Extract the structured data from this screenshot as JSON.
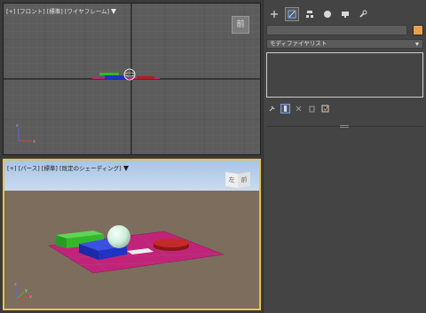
{
  "viewports": {
    "top": {
      "label": "[+] [フロント] [標準] [ワイヤフレーム]",
      "cube_label": "前"
    },
    "perspective": {
      "label": "[+] [パース] [標準] [既定のシェーディング]",
      "cube_left": "左",
      "cube_right": "前"
    }
  },
  "command_panel": {
    "tabs": [
      "create-tab",
      "modify-tab",
      "hierarchy-tab",
      "motion-tab",
      "display-tab",
      "utilities-tab"
    ],
    "active_tab": "modify-tab",
    "object_name": "",
    "object_color": "#e6a14a",
    "modifier_list_label": "モディファイヤリスト",
    "stack_tools": [
      "pin-stack-icon",
      "show-end-result-icon",
      "make-unique-icon",
      "remove-modifier-icon",
      "configure-modifier-sets-icon"
    ]
  },
  "colors": {
    "sky": "#b4cce8",
    "ground": "#7c6d5d",
    "plane": "#c2237a",
    "box_green": "#33b82c",
    "box_blue": "#1f33c4",
    "sphere": "#d4f0de",
    "cylinder": "#b21e1e",
    "selection": "#e8c34a"
  }
}
